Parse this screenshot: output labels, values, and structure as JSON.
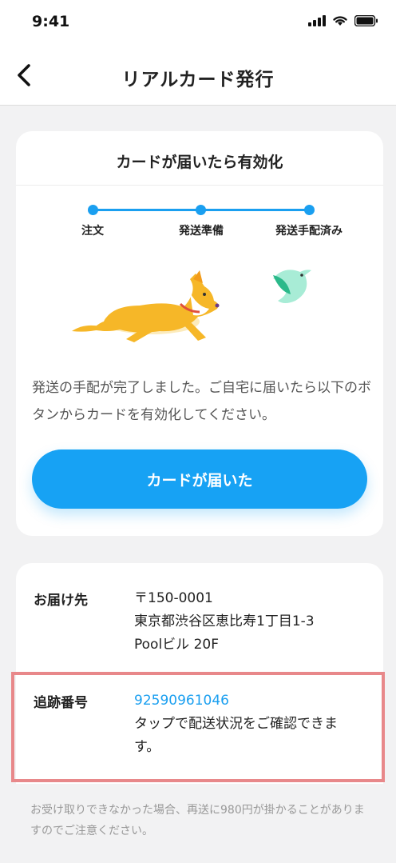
{
  "status_bar": {
    "time": "9:41"
  },
  "nav": {
    "title": "リアルカード発行"
  },
  "card": {
    "header": "カードが届いたら有効化",
    "steps": [
      "注文",
      "発送準備",
      "発送手配済み"
    ],
    "message": "発送の手配が完了しました。ご自宅に届いたら以下のボタンからカードを有効化してください。",
    "button_label": "カードが届いた"
  },
  "delivery": {
    "address_label": "お届け先",
    "address_lines": [
      "〒150-0001",
      "東京都渋谷区恵比寿1丁目1-3",
      "Poolビル 20F"
    ],
    "tracking_label": "追跡番号",
    "tracking_number": "92590961046",
    "tracking_note": "タップで配送状況をご確認できます。"
  },
  "footnote": "お受け取りできなかった場合、再送に980円が掛かることがありますのでご注意ください。",
  "colors": {
    "accent": "#17a2f4",
    "highlight": "#e8888a"
  }
}
